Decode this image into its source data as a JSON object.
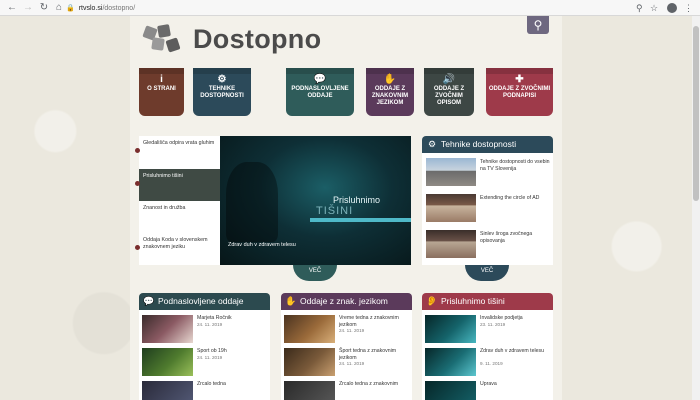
{
  "browser": {
    "url_domain": "rtvslo.si",
    "url_path": "/dostopno/"
  },
  "site": {
    "title": "Dostopno"
  },
  "tiles": [
    {
      "label": "O STRANI",
      "icon": "i",
      "color": "#6e3b2c"
    },
    {
      "label": "TEHNIKE DOSTOPNOSTI",
      "icon": "⚙",
      "color": "#2c4a5a"
    },
    {
      "label": "PODNASLOVLJENE ODDAJE",
      "icon": "💬",
      "color": "#2f5c5a"
    },
    {
      "label": "ODDAJE Z ZNAKOVNIM JEZIKOM",
      "icon": "✋",
      "color": "#5b3a5b"
    },
    {
      "label": "ODDAJE Z ZVOČNIM OPISOM",
      "icon": "🔊",
      "color": "#3d4744"
    },
    {
      "label": "ODDAJE Z ZVOČNIMI PODNAPISI",
      "icon": "✚",
      "color": "#9e3a4a"
    }
  ],
  "featured": {
    "items": [
      "Gledališča odpira vrata gluhim",
      "Prisluhnimo tišini",
      "Znanost in družba",
      "Oddaja Koda v slovenskem znakovnem jeziku"
    ],
    "caption": "Zdrav duh v zdravem telesu",
    "brand_line1": "Prisluhnimo",
    "brand_line2": "TIŠINI",
    "more": "VEČ"
  },
  "tech_panel": {
    "title": "Tehnike dostopnosti",
    "items": [
      "Tehnike dostopnosti do vsebin na TV Slovenija",
      "Extending the circle of AD",
      "Sinlev šroga zvočnega opisovanja"
    ],
    "more": "VEČ"
  },
  "panels": [
    {
      "title": "Podnaslovljene oddaje",
      "color": "#2c4a4f",
      "items": [
        {
          "title": "Marjeta Ročnik",
          "date": "24. 11. 2019"
        },
        {
          "title": "Sport ob 19h",
          "date": "24. 11. 2019"
        },
        {
          "title": "Zrcalo tedna",
          "date": ""
        }
      ]
    },
    {
      "title": "Oddaje z znak. jezikom",
      "color": "#5b3a5b",
      "items": [
        {
          "title": "Vreme tedna z znakovnim jezikom",
          "date": "24. 11. 2019"
        },
        {
          "title": "Šport tedna z znakovnim jezikom",
          "date": "24. 11. 2019"
        },
        {
          "title": "Zrcalo tedna z znakovnim",
          "date": ""
        }
      ]
    },
    {
      "title": "Prisluhnimo tišini",
      "color": "#9e3a4a",
      "items": [
        {
          "title": "Invalidske podjetja",
          "date": "23. 11. 2019"
        },
        {
          "title": "Zdrav duh v zdravem telesu",
          "date": "9. 11. 2019"
        },
        {
          "title": "Uprava",
          "date": ""
        }
      ]
    }
  ]
}
